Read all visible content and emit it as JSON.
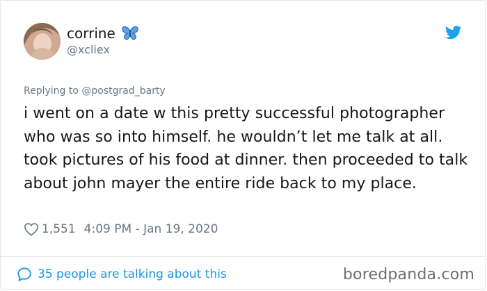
{
  "user": {
    "display_name": "corrine",
    "handle": "@xcliex",
    "name_emoji": "butterfly-icon"
  },
  "tweet": {
    "replying_to": "Replying to @postgrad_barty",
    "text": "i went on a date w this pretty successful photographer who was so into himself. he wouldn’t let me talk at all. took pictures of his food at dinner. then proceeded to talk about john mayer the entire ride back to my place.",
    "likes": "1,551",
    "timestamp": "4:09 PM - Jan 19, 2020"
  },
  "footer": {
    "conversation": "35 people are talking about this",
    "watermark": "boredpanda.com"
  },
  "colors": {
    "twitter_blue": "#1da1f2",
    "link_blue": "#1b95e0",
    "secondary_text": "#657786",
    "primary_text": "#14171a",
    "border": "#e1e8ed"
  }
}
